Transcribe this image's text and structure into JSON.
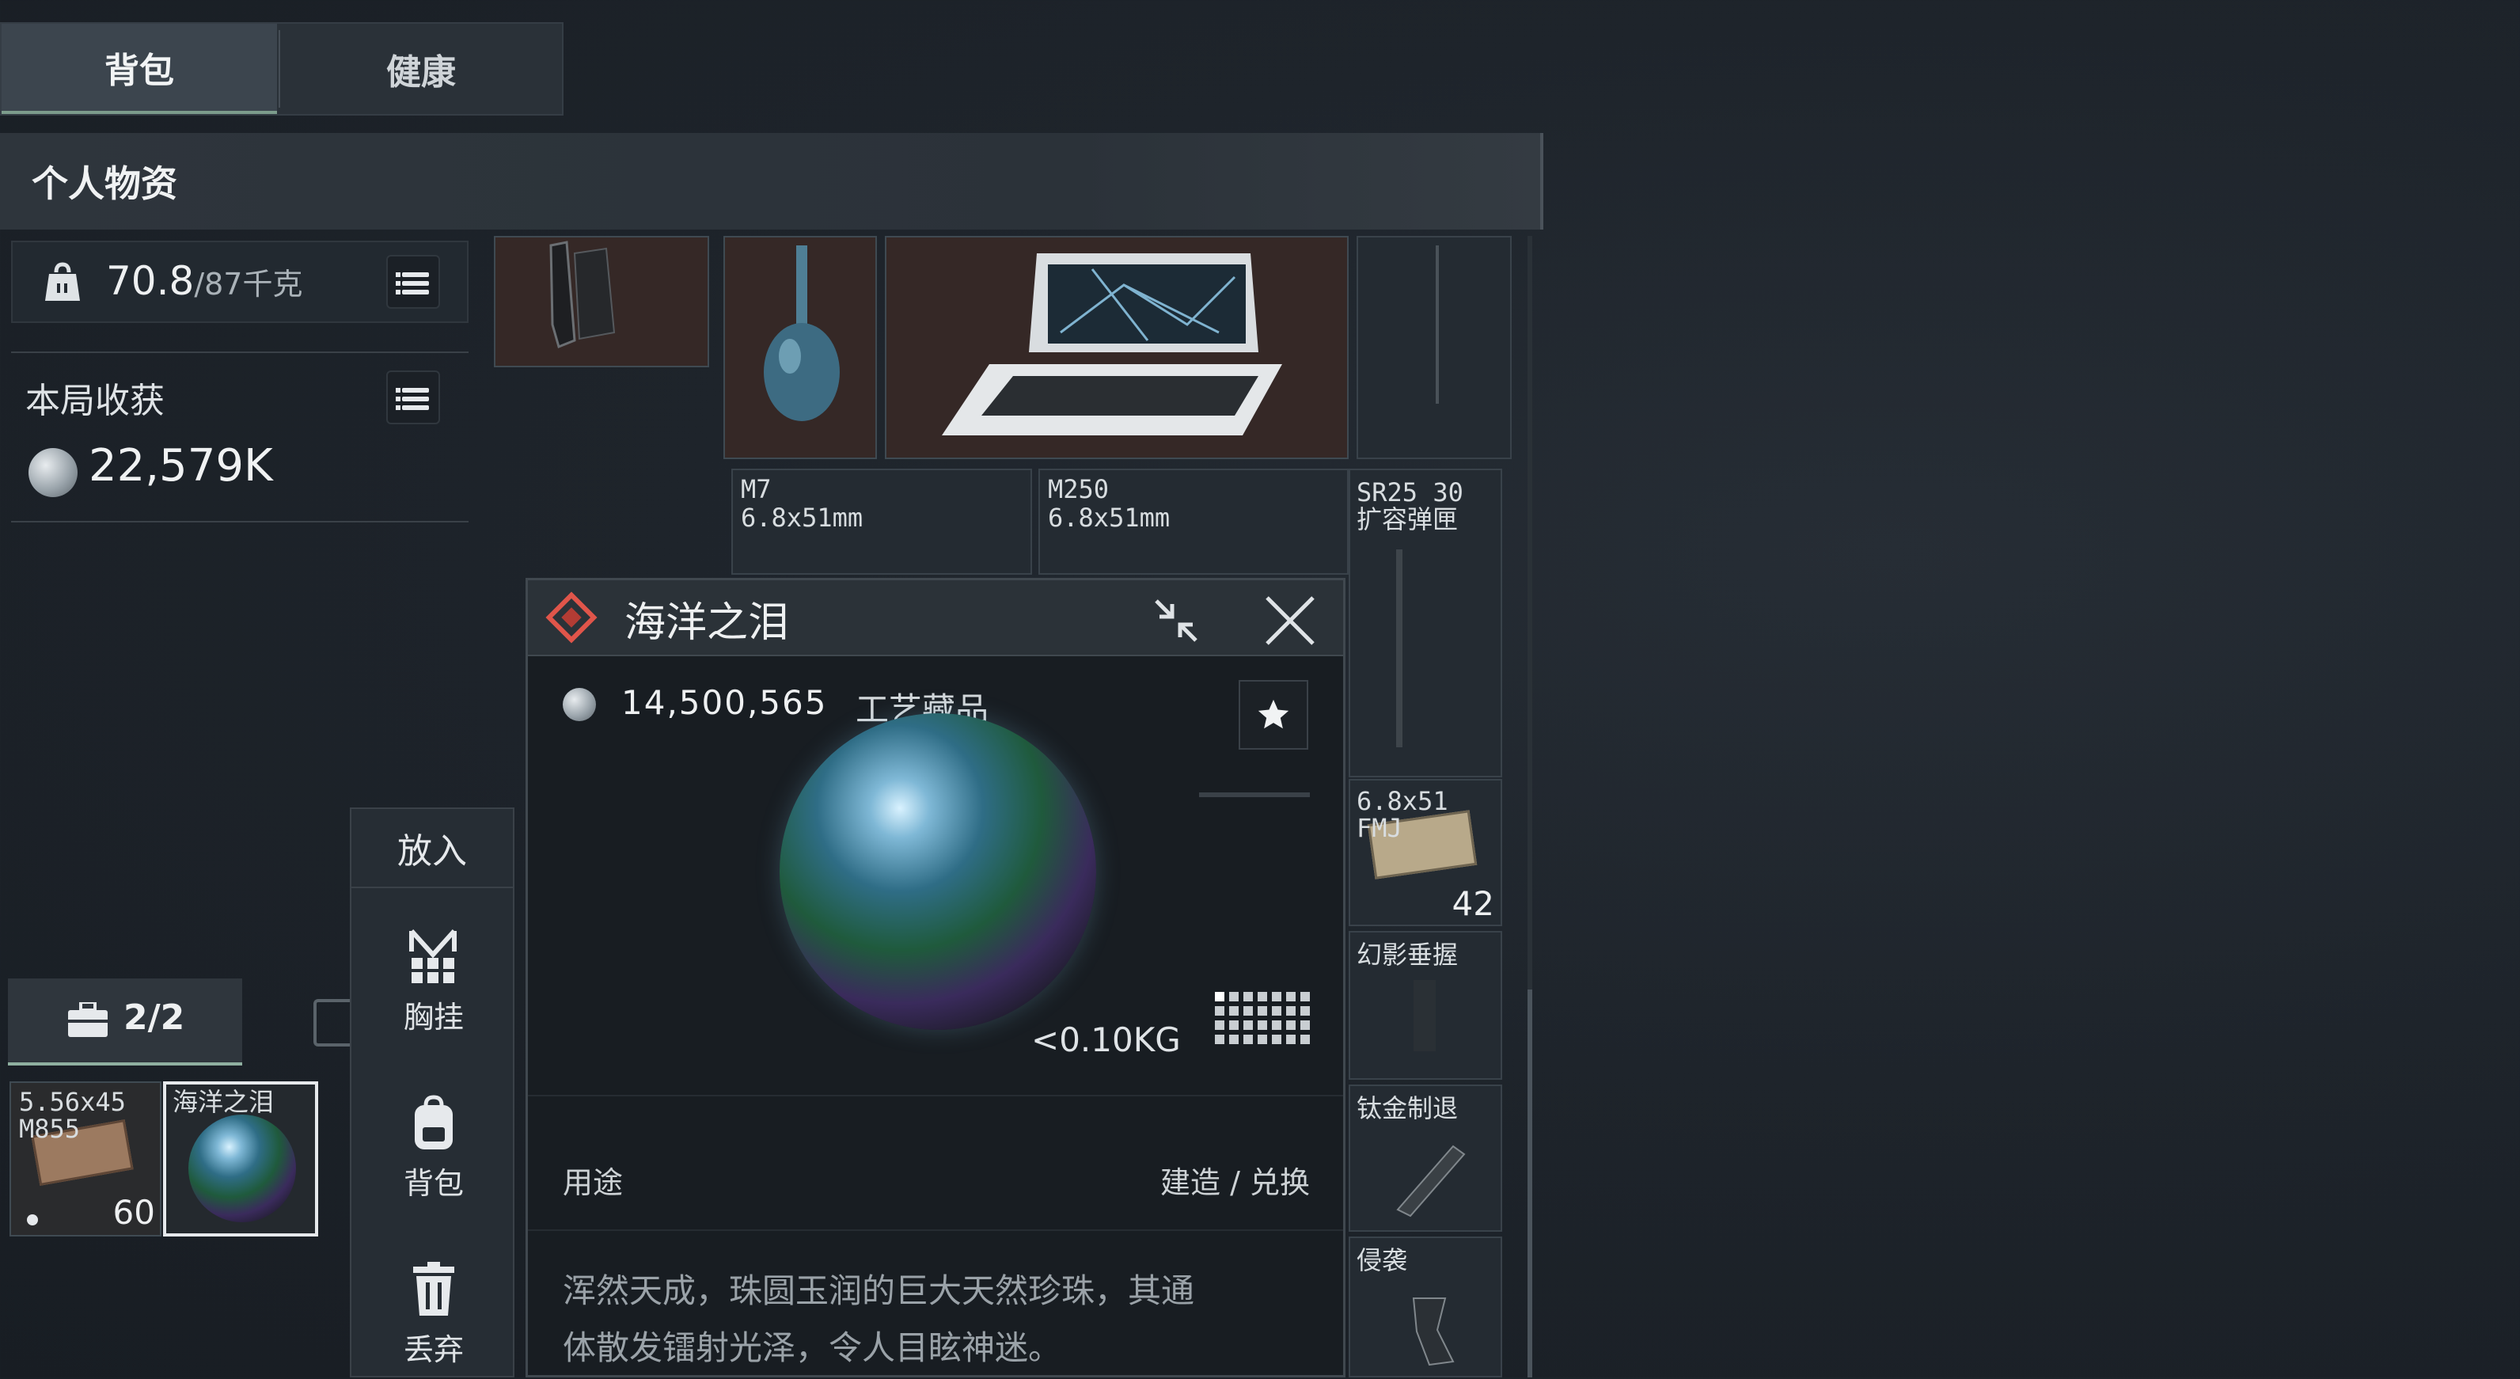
{
  "tabs": [
    {
      "label": "背包",
      "active": true
    },
    {
      "label": "健康",
      "active": false
    }
  ],
  "header": {
    "title": "个人物资"
  },
  "weight": {
    "current": "70.8",
    "max": "/87千克"
  },
  "session": {
    "label": "本局收获",
    "value": "22,579K"
  },
  "grid_labels": {
    "m7_name": "M7",
    "m7_caliber": "6.8x51mm",
    "m250_name": "M250",
    "m250_caliber": "6.8x51mm",
    "sr25_line1": "SR25 30",
    "sr25_line2": "扩容弹匣",
    "ammo_line1": "6.8x51",
    "ammo_line2": "FMJ",
    "ammo_count": "42",
    "grip_label": "幻影垂握",
    "stock_label": "钛金制退",
    "raid_label": "侵袭"
  },
  "item_detail": {
    "name": "海洋之泪",
    "price": "14,500,565",
    "category": "工艺藏品",
    "weight": "<0.10KG",
    "usage_label": "用途",
    "usage_value": "建造 / 兑换",
    "description_line1": "浑然天成，珠圆玉润的巨大天然珍珠，其通",
    "description_line2": "体散发镭射光泽，令人目眩神迷。"
  },
  "action_menu": {
    "title": "放入",
    "items": [
      {
        "label": "胸挂",
        "icon": "chest-rig-icon"
      },
      {
        "label": "背包",
        "icon": "backpack-icon"
      },
      {
        "label": "丢弃",
        "icon": "trash-icon"
      }
    ]
  },
  "bottom": {
    "toolbox_count": "2/2",
    "slot1_line1": "5.56x45",
    "slot1_line2": "M855",
    "slot1_count": "60",
    "slot2_label": "海洋之泪"
  },
  "colors": {
    "rarity": "#e0554a",
    "accent": "#8fb0a0",
    "panel_bg": "#181d22",
    "cell_item_bg": "#352826"
  }
}
